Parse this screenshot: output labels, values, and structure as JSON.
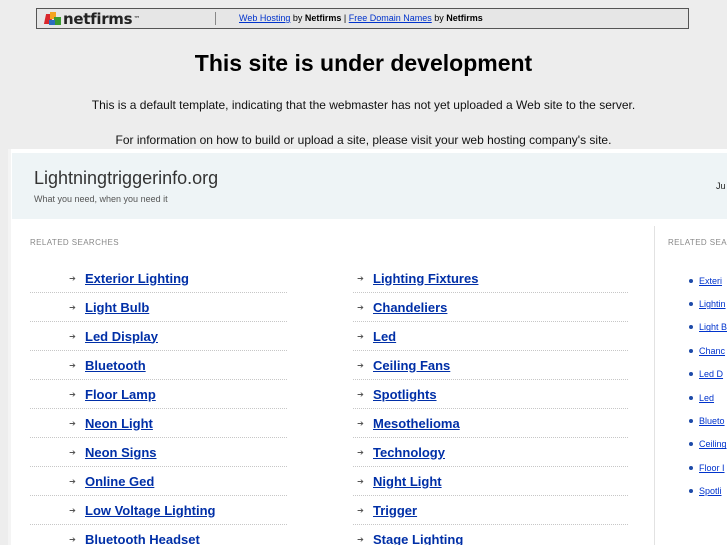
{
  "banner": {
    "logo_text": "netfirms",
    "logo_tm": "™",
    "link1": "Web Hosting",
    "by1": " by ",
    "brand1": "Netfirms",
    "sep": " | ",
    "link2": "Free Domain Names",
    "by2": " by ",
    "brand2": "Netfirms"
  },
  "notice": {
    "title": "This site is under development",
    "line1": "This is a default template, indicating that the webmaster has not yet uploaded a Web site to the server.",
    "line2": "For information on how to build or upload a site, please visit your web hosting company's site."
  },
  "site": {
    "name": "Lightningtriggerinfo.org",
    "tagline": "What you need, when you need it",
    "header_right": "Ju"
  },
  "related": {
    "label": "RELATED SEARCHES",
    "left_column": [
      "Exterior Lighting",
      "Light Bulb",
      "Led Display",
      "Bluetooth",
      "Floor Lamp",
      "Neon Light",
      "Neon Signs",
      "Online Ged",
      "Low Voltage Lighting",
      "Bluetooth Headset"
    ],
    "right_column": [
      "Lighting Fixtures",
      "Chandeliers",
      "Led",
      "Ceiling Fans",
      "Spotlights",
      "Mesothelioma",
      "Technology",
      "Night Light",
      "Trigger",
      "Stage Lighting"
    ]
  },
  "sidebar": {
    "label": "RELATED SEA",
    "items": [
      "Exteri",
      "Lightin",
      "Light B",
      "Chanc",
      "Led D",
      "Led",
      "Blueto",
      "Ceiling",
      "Floor I",
      "Spotli"
    ]
  },
  "colors": {
    "link": "#002fa7",
    "page_bg": "#ededed",
    "header_bg": "#eef4f6"
  },
  "icons": {
    "list_arrow": "arrow-right-icon",
    "side_bullet": "bullet-icon"
  }
}
